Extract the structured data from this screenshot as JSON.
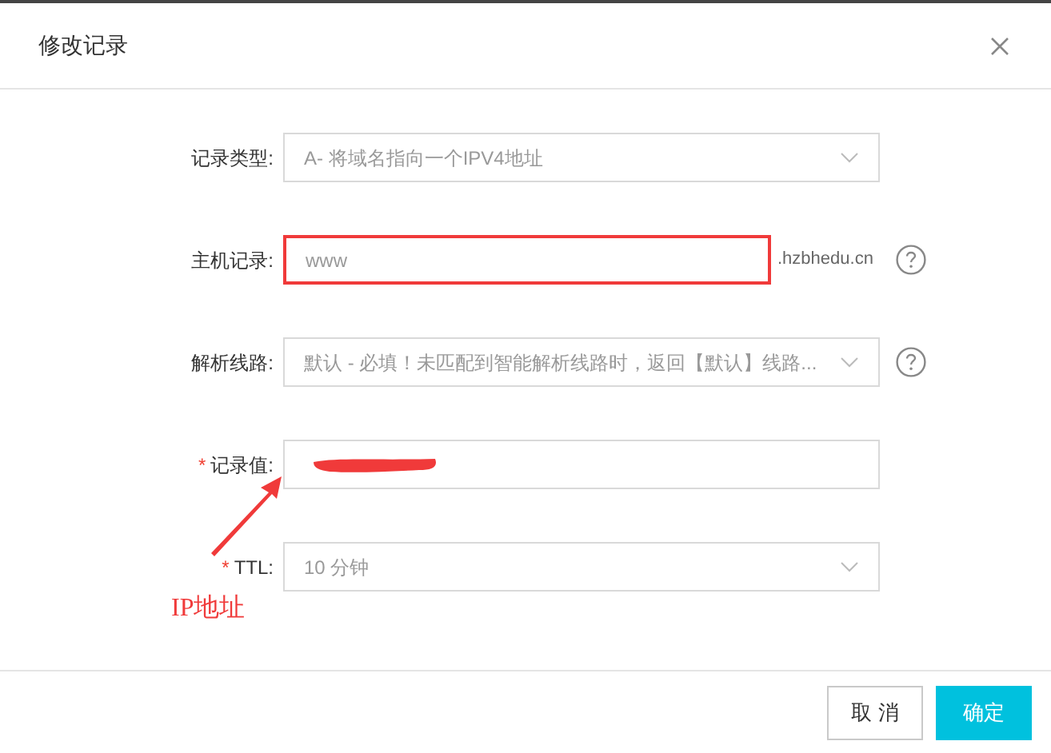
{
  "dialog": {
    "title": "修改记录"
  },
  "fields": [
    {
      "kind": "select",
      "label": "记录类型:",
      "value": "A- 将域名指向一个IPV4地址",
      "help": false,
      "highlighted": false
    },
    {
      "kind": "input",
      "label": "主机记录:",
      "value": "www",
      "suffix": ".hzbhedu.cn",
      "help": true,
      "highlighted": true
    },
    {
      "kind": "select",
      "label": "解析线路:",
      "value": "默认 - 必填！未匹配到智能解析线路时，返回【默认】线路...",
      "help": true,
      "highlighted": false
    },
    {
      "kind": "input",
      "label": "记录值:",
      "required_mark": "*",
      "redacted": true,
      "help": false,
      "highlighted": false
    },
    {
      "kind": "select",
      "label": "TTL:",
      "required_mark": "*",
      "value": "10 分钟",
      "help": false,
      "highlighted": false
    }
  ],
  "annotation": {
    "text": "IP地址"
  },
  "buttons": [
    {
      "label": "取 消",
      "kind": "secondary"
    },
    {
      "label": "确定",
      "kind": "primary"
    }
  ]
}
